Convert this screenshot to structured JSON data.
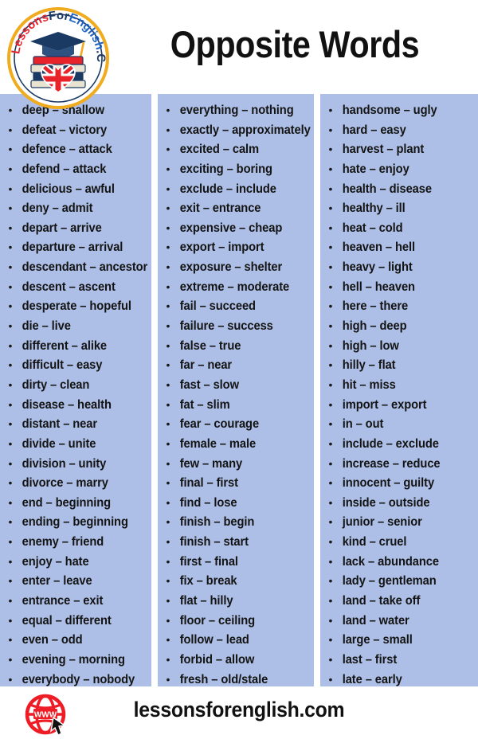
{
  "header": {
    "title": "Opposite Words",
    "logo": {
      "name": "lessonsforenglish-logo",
      "text_part_1": "Lessons",
      "text_part_2": "For",
      "text_part_3": "English",
      "text_part_4": ".Com",
      "color_red": "#e8232a",
      "color_navy": "#1b3a63",
      "color_blue": "#1f64c4",
      "color_ring": "#f0ab1e"
    }
  },
  "colors": {
    "panel_blue": "#adbfe6",
    "text_black": "#141414",
    "page_background": "#ffffff",
    "footer_icon_red": "#ee1c25"
  },
  "columns": [
    {
      "name": "column-1",
      "items": [
        "deep – shallow",
        "defeat – victory",
        "defence – attack",
        "defend – attack",
        "delicious – awful",
        "deny – admit",
        "depart – arrive",
        "departure – arrival",
        "descendant – ancestor",
        "descent – ascent",
        "desperate – hopeful",
        "die – live",
        "different – alike",
        "difficult – easy",
        "dirty – clean",
        "disease – health",
        "distant – near",
        "divide – unite",
        "division – unity",
        "divorce – marry",
        "end – beginning",
        "ending – beginning",
        "enemy – friend",
        "enjoy – hate",
        "enter – leave",
        "entrance – exit",
        "equal – different",
        "even – odd",
        "evening – morning",
        "everybody – nobody"
      ]
    },
    {
      "name": "column-2",
      "items": [
        "everything – nothing",
        "exactly – approximately",
        "excited – calm",
        "exciting – boring",
        "exclude – include",
        "exit – entrance",
        "expensive – cheap",
        "export – import",
        "exposure – shelter",
        "extreme – moderate",
        "fail – succeed",
        "failure – success",
        "false – true",
        "far – near",
        "fast – slow",
        "fat – slim",
        "fear – courage",
        "female – male",
        "few – many",
        "final – first",
        "find – lose",
        "finish – begin",
        "finish – start",
        "first – final",
        "fix – break",
        "flat – hilly",
        "floor – ceiling",
        "follow – lead",
        "forbid – allow",
        "fresh – old/stale"
      ]
    },
    {
      "name": "column-3",
      "items": [
        "handsome – ugly",
        "hard – easy",
        "harvest – plant",
        "hate – enjoy",
        "health – disease",
        "healthy – ill",
        "heat – cold",
        "heaven – hell",
        "heavy – light",
        "hell – heaven",
        "here – there",
        "high – deep",
        "high – low",
        "hilly – flat",
        "hit – miss",
        "import – export",
        "in – out",
        "include – exclude",
        "increase – reduce",
        "innocent – guilty",
        "inside – outside",
        "junior – senior",
        "kind – cruel",
        "lack – abundance",
        "lady – gentleman",
        "land – take off",
        "land – water",
        "large – small",
        "last – first",
        "late – early"
      ]
    }
  ],
  "footer": {
    "website": "lessonsforenglish.com",
    "icon_name": "www-globe-cursor-icon",
    "icon_label": "WWW"
  }
}
